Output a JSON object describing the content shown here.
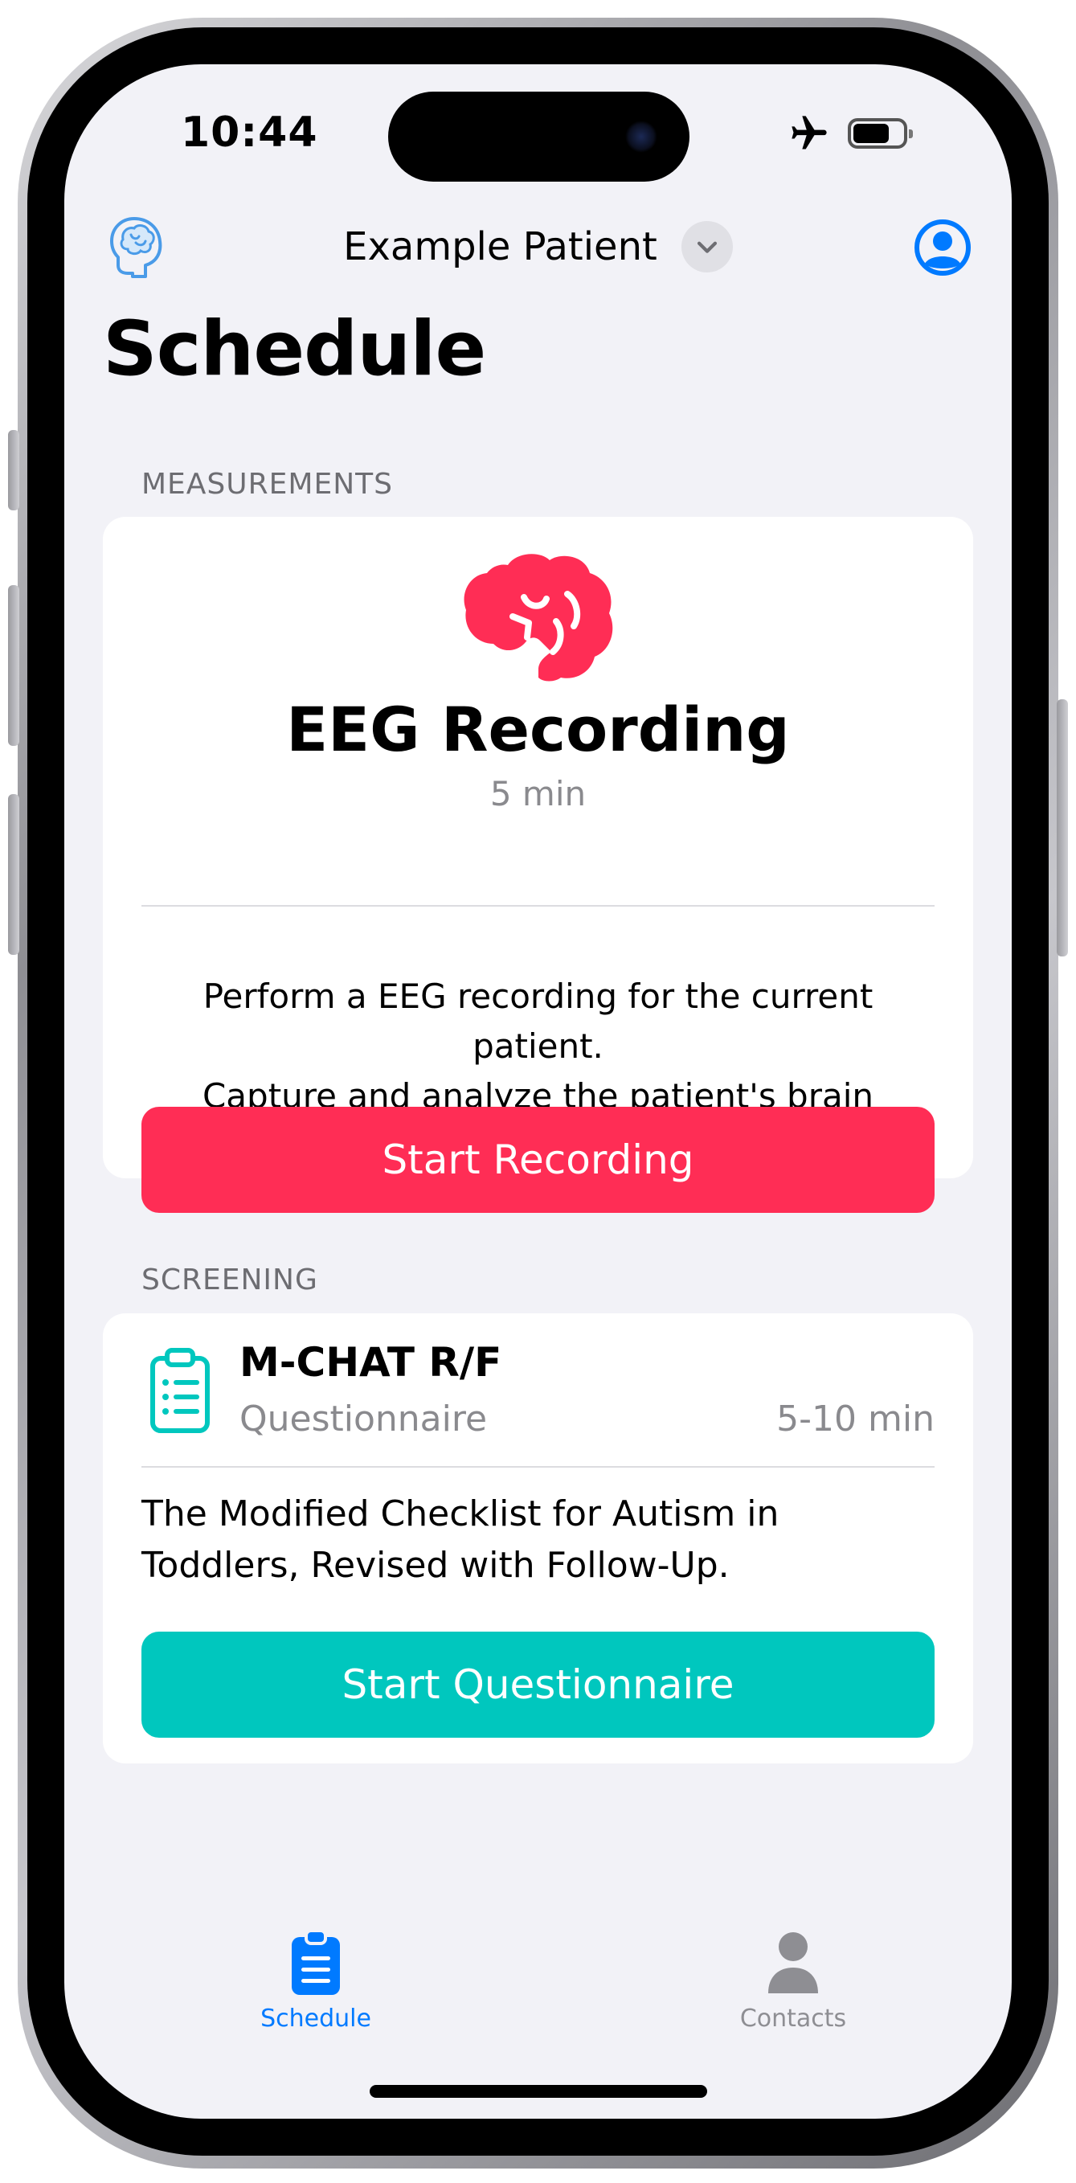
{
  "status_bar": {
    "time": "10:44"
  },
  "nav": {
    "patient_name": "Example Patient"
  },
  "page": {
    "title": "Schedule"
  },
  "measurements": {
    "header": "MEASUREMENTS",
    "eeg": {
      "title": "EEG Recording",
      "duration": "5 min",
      "description_line1": "Perform a EEG recording for the current patient.",
      "description_line2": "Capture and analyze the patient's brain activity.",
      "button_label": "Start Recording",
      "accent_color": "#ff2d55",
      "icon": "brain-icon"
    }
  },
  "screening": {
    "header": "SCREENING",
    "mchat": {
      "title": "M-CHAT R/F",
      "subtitle": "Questionnaire",
      "duration": "5-10 min",
      "description_line1": "The Modified Checklist for Autism in",
      "description_line2": "Toddlers, Revised with Follow-Up.",
      "button_label": "Start Questionnaire",
      "accent_color": "#00c7be",
      "icon": "clipboard-list-icon"
    }
  },
  "tab_bar": {
    "tabs": [
      {
        "label": "Schedule",
        "icon": "clipboard-icon",
        "selected": true,
        "color": "#007aff"
      },
      {
        "label": "Contacts",
        "icon": "person-icon",
        "selected": false,
        "color": "#8e8e93"
      }
    ]
  }
}
